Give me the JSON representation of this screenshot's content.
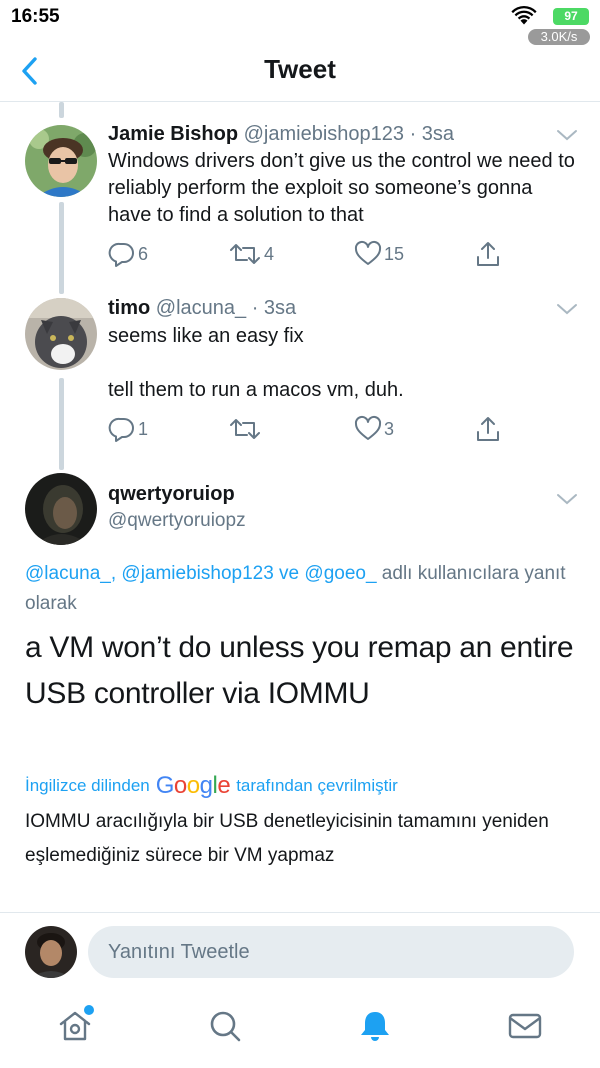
{
  "status_bar": {
    "time": "16:55",
    "battery": "97",
    "net_speed": "3.0K/s"
  },
  "header": {
    "title": "Tweet"
  },
  "thread": [
    {
      "name": "Jamie Bishop",
      "handle": "@jamiebishop123",
      "time": "· 3sa",
      "text": "Windows drivers don’t give us the control we need to reliably perform the exploit so someone’s gonna have to find a solution to that",
      "replies": "6",
      "retweets": "4",
      "likes": "15"
    },
    {
      "name": "timo",
      "handle": "@lacuna_",
      "time": "· 3sa",
      "text_line1": "seems like an easy fix",
      "text_line2": "tell them to run a macos vm, duh.",
      "replies": "1",
      "retweets": "",
      "likes": "3"
    }
  ],
  "focused": {
    "name": "qwertyoruiop",
    "handle": "@qwertyoruiopz",
    "reply_mentions": "@lacuna_, @jamiebishop123 ve @goeo_",
    "reply_suffix": " adlı kullanıcılara yanıt olarak",
    "text": "a VM won’t do unless you remap an entire USB controller via IOMMU",
    "translate_prefix": "İngilizce dilinden",
    "translate_brand": "Google",
    "translate_suffix": "tarafından çevrilmiştir",
    "translated_text": "IOMMU aracılığıyla bir USB denetleyicisinin tamamını yeniden eşlemediğiniz sürece bir VM yapmaz"
  },
  "reply_bar": {
    "placeholder": "Yanıtını Tweetle"
  },
  "colors": {
    "accent": "#1da1f2",
    "secondary_text": "#657786",
    "battery": "#4cd964"
  },
  "icons": {
    "tabs": [
      "home-icon",
      "search-icon",
      "notifications-icon",
      "messages-icon"
    ],
    "actions": [
      "reply-icon",
      "retweet-icon",
      "like-icon",
      "share-icon"
    ]
  }
}
